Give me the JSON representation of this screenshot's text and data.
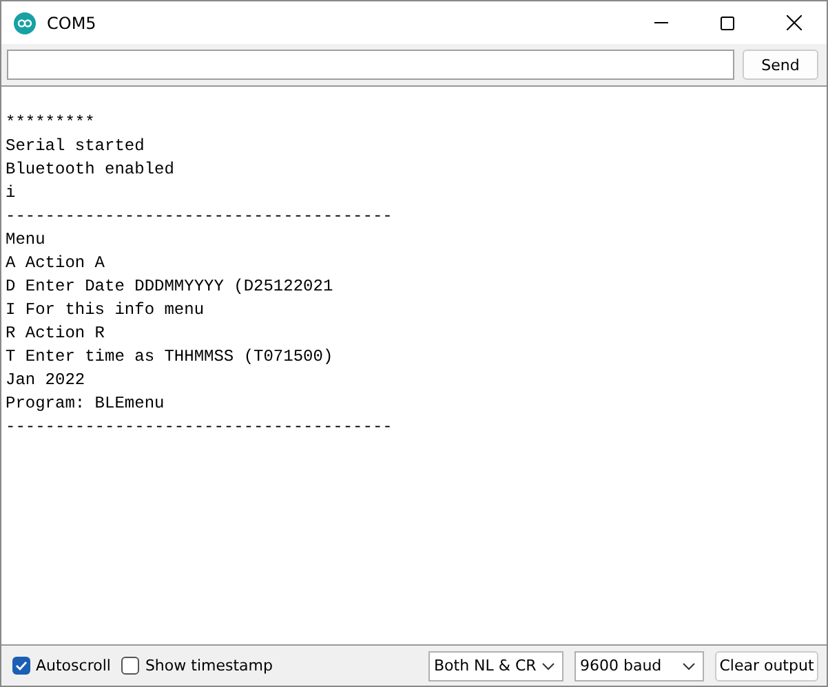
{
  "window": {
    "title": "COM5"
  },
  "send": {
    "button": "Send"
  },
  "output": {
    "lines": [
      "*********",
      "Serial started",
      "Bluetooth enabled",
      "i",
      "---------------------------------------",
      "Menu",
      "A Action A",
      "D Enter Date DDDMMYYYY (D25122021",
      "I For this info menu",
      "R Action R",
      "T Enter time as THHMMSS (T071500)",
      "Jan 2022",
      "Program: BLEmenu",
      "---------------------------------------"
    ]
  },
  "status_bar": {
    "autoscroll": {
      "label": "Autoscroll",
      "checked": true
    },
    "timestamp": {
      "label": "Show timestamp",
      "checked": false
    },
    "line_ending": "Both NL & CR",
    "baud": "9600 baud",
    "clear_button": "Clear output"
  }
}
